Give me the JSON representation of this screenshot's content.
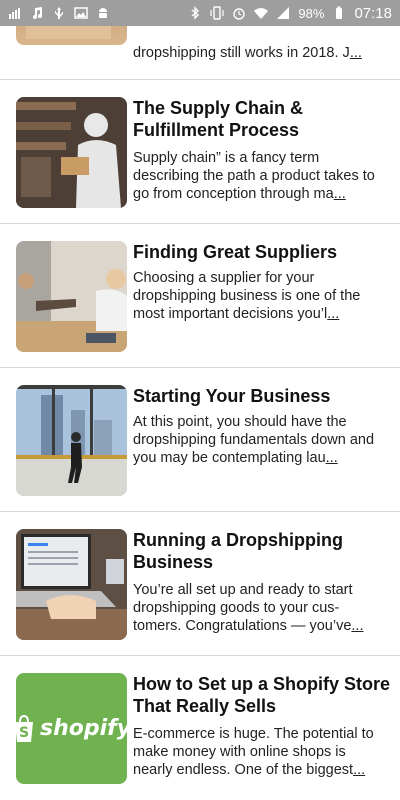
{
  "status_bar": {
    "battery_percent": "98%",
    "time": "07:18",
    "left_icons": [
      "signal-bars-icon",
      "music-icon",
      "usb-icon",
      "image-icon",
      "android-icon"
    ],
    "right_icons": [
      "bluetooth-icon",
      "vibrate-icon",
      "alarm-icon",
      "wifi-icon",
      "cell-signal-icon",
      "battery-icon"
    ]
  },
  "articles": [
    {
      "title": "",
      "description": "dropshipping still works in 2018. J",
      "more": "...",
      "image": "box-photo"
    },
    {
      "title": "The Supply Chain & Fulfillment Process",
      "description": "Supply chain” is a fancy term describing the path a product takes to go from conception through ma",
      "more": "...",
      "image": "warehouse-worker-photo"
    },
    {
      "title": "Finding Great Suppliers",
      "description": "Choosing a supplier for your dropshipping business is one of the most important decisions you’l",
      "more": "...",
      "image": "handshake-meeting-photo"
    },
    {
      "title": "Starting Your Business",
      "description": "At this point, you should have the dropshipping fundamentals down and you may be contemplating lau",
      "more": "...",
      "image": "businessman-walking-photo"
    },
    {
      "title": "Running a Dropshipping Business",
      "description": "You’re all set up and ready to start dropshipping goods to your cus-tomers. Congratulations — you’ve",
      "more": "...",
      "image": "laptop-typing-photo"
    },
    {
      "title": "How to Set up a Shopify Store That Really Sells",
      "description": "E-commerce is huge. The potential to make money with online shops is nearly endless. One of the biggest",
      "more": "...",
      "image": "shopify-logo",
      "logo_text": "shopify",
      "logo_color": "#6fb24f"
    }
  ]
}
